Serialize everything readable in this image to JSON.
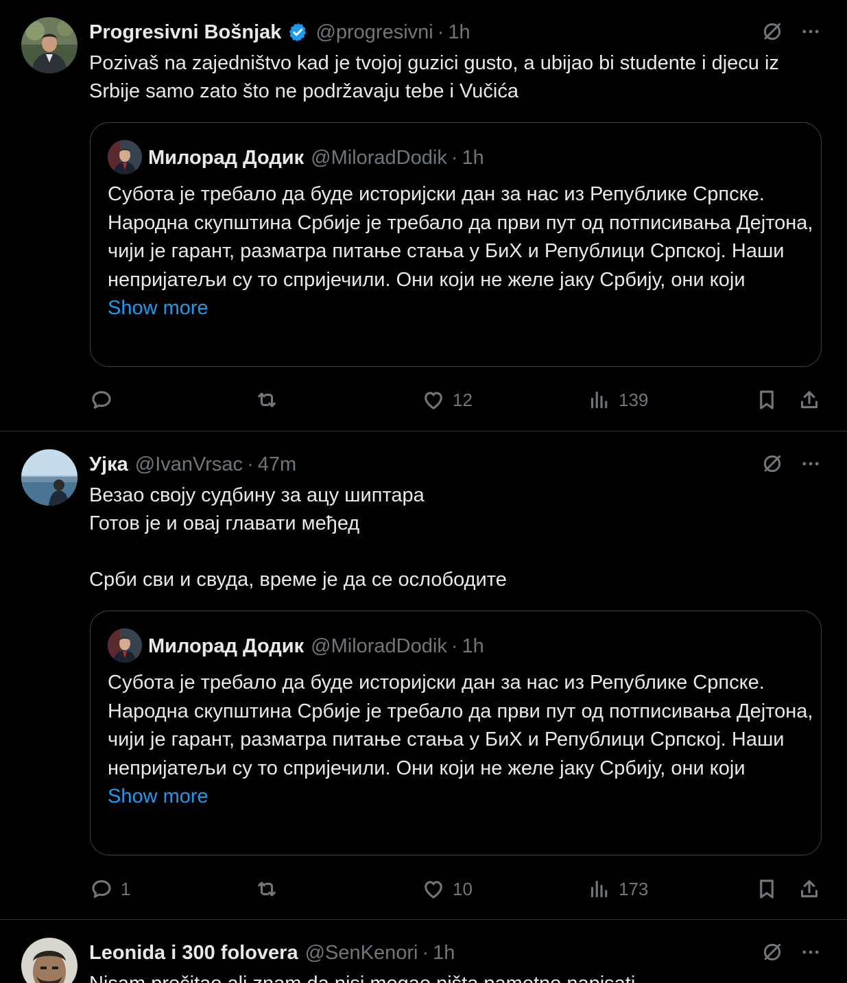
{
  "tweets": [
    {
      "author": "Progresivni Bošnjak",
      "handle": "@progresivni",
      "time": "1h",
      "verified": true,
      "text": "Pozivaš na zajedništvo kad je tvojoj guzici gusto, a ubijao bi studente i djecu iz Srbije samo zato što ne podržavaju tebe i Vučića",
      "quote": {
        "author": "Милорад Додик",
        "handle": "@MiloradDodik",
        "time": "1h",
        "text": "Субота је требало да буде историјски дан за нас из Републике Српске. Народна скупштина Србије је требало да први пут од потписивања Дејтона, чији је гарант, разматра питање стања у БиХ и Републици Српској. Наши непријатељи су то спријечили. Они који не желе јаку Србију, они који",
        "show_more": "Show more"
      },
      "actions": {
        "replies": "",
        "reposts": "",
        "likes": "12",
        "views": "139"
      }
    },
    {
      "author": "Ујка",
      "handle": "@IvanVrsac",
      "time": "47m",
      "verified": false,
      "text": "Везао своју судбину за ацу шиптара\nГотов је и овај главати међед\n\nСрби сви и свуда, време је да се ослободите",
      "quote": {
        "author": "Милорад Додик",
        "handle": "@MiloradDodik",
        "time": "1h",
        "text": "Субота је требало да буде историјски дан за нас из Републике Српске. Народна скупштина Србије је требало да први пут од потписивања Дејтона, чији је гарант, разматра питање стања у БиХ и Републици Српској. Наши непријатељи су то спријечили. Они који не желе јаку Србију, они који",
        "show_more": "Show more"
      },
      "actions": {
        "replies": "1",
        "reposts": "",
        "likes": "10",
        "views": "173"
      }
    },
    {
      "author": "Leonida i 300 folovera",
      "handle": "@SenKenori",
      "time": "1h",
      "verified": false,
      "text": "Nisam pročitao ali znam da nisi mogao ništa pametno napisati"
    }
  ],
  "colors": {
    "background": "#000000",
    "text": "#e7e9ea",
    "muted": "#71767b",
    "link": "#1d9bf0",
    "verified": "#1d9bf0",
    "divider": "#2f3336"
  },
  "icons": {
    "verified": "verified-badge-icon",
    "grok": "grok-icon",
    "more": "more-icon",
    "reply": "reply-icon",
    "repost": "repost-icon",
    "like": "heart-icon",
    "views": "views-icon",
    "bookmark": "bookmark-icon",
    "share": "share-icon"
  }
}
